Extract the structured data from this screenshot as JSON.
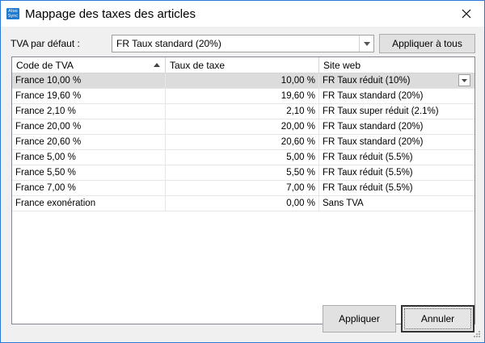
{
  "window": {
    "title": "Mappage des taxes des articles",
    "app_icon_line1": "Atoo",
    "app_icon_line2": "Sync",
    "close_icon": "close-icon"
  },
  "default_vat": {
    "label": "TVA par défaut :",
    "selected": "FR Taux standard (20%)",
    "apply_all_label": "Appliquer à tous"
  },
  "grid": {
    "columns": [
      "Code de TVA",
      "Taux de taxe",
      "Site web"
    ],
    "sort_column": "Code de TVA",
    "rows": [
      {
        "code": "France 10,00 %",
        "rate": "10,00 %",
        "site": "FR Taux réduit (10%)",
        "selected": true
      },
      {
        "code": "France 19,60 %",
        "rate": "19,60 %",
        "site": "FR Taux standard (20%)"
      },
      {
        "code": "France 2,10 %",
        "rate": "2,10 %",
        "site": "FR Taux super réduit (2.1%)"
      },
      {
        "code": "France 20,00 %",
        "rate": "20,00 %",
        "site": "FR Taux standard (20%)"
      },
      {
        "code": "France 20,60 %",
        "rate": "20,60 %",
        "site": "FR Taux standard (20%)"
      },
      {
        "code": "France 5,00 %",
        "rate": "5,00 %",
        "site": "FR Taux réduit (5.5%)"
      },
      {
        "code": "France 5,50 %",
        "rate": "5,50 %",
        "site": "FR Taux réduit (5.5%)"
      },
      {
        "code": "France 7,00 %",
        "rate": "7,00 %",
        "site": "FR Taux réduit (5.5%)"
      },
      {
        "code": "France exonération",
        "rate": "0,00 %",
        "site": "Sans TVA"
      }
    ]
  },
  "buttons": {
    "apply_label": "Appliquer",
    "cancel_label": "Annuler"
  },
  "colors": {
    "title_border": "#2b79d6",
    "selected_row": "#dcdcdc",
    "app_icon": "#1f7ad1"
  }
}
